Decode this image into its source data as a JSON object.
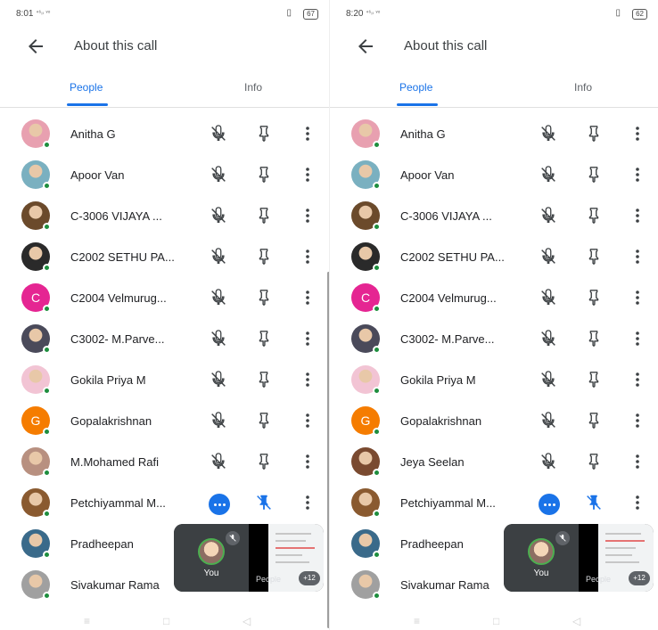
{
  "colors": {
    "accent": "#1a73e8",
    "online": "#1e8e3e",
    "text": "#202124",
    "icon": "#3c4043"
  },
  "screens": [
    {
      "status": {
        "time": "8:01",
        "signal": "⁴⁶ᵢₗ ᵛᵒ",
        "battery": "67"
      },
      "title": "About this call",
      "tabs": {
        "people": "People",
        "info": "Info"
      },
      "participants": [
        {
          "name": "Anitha G",
          "avatar": "photo",
          "color": "#e8a0b0",
          "action": "mute"
        },
        {
          "name": "Apoor Van",
          "avatar": "photo",
          "color": "#7ab0c0",
          "action": "mute"
        },
        {
          "name": "C-3006 VIJAYA ...",
          "avatar": "photo",
          "color": "#6b4a2b",
          "action": "mute"
        },
        {
          "name": "C2002 SETHU PA...",
          "avatar": "photo",
          "color": "#2a2a2a",
          "action": "mute"
        },
        {
          "name": "C2004 Velmurug...",
          "avatar": "letter",
          "initial": "C",
          "color": "#e52592",
          "action": "mute"
        },
        {
          "name": "C3002- M.Parve...",
          "avatar": "photo",
          "color": "#4a4a5a",
          "action": "mute"
        },
        {
          "name": "Gokila Priya M",
          "avatar": "photo",
          "color": "#f2c4d4",
          "action": "mute"
        },
        {
          "name": "Gopalakrishnan",
          "avatar": "letter",
          "initial": "G",
          "color": "#f57c00",
          "action": "mute"
        },
        {
          "name": "M.Mohamed Rafi",
          "avatar": "photo",
          "color": "#b89080",
          "action": "mute"
        },
        {
          "name": "Petchiyammal M...",
          "avatar": "photo",
          "color": "#8a5a30",
          "action": "talking"
        },
        {
          "name": "Pradheepan",
          "avatar": "photo",
          "color": "#3a6a8a",
          "action": "none"
        },
        {
          "name": "Sivakumar Rama",
          "avatar": "photo",
          "color": "#a0a0a0",
          "action": "none"
        }
      ],
      "pip": {
        "you": "You",
        "people": "People",
        "count": "+12"
      }
    },
    {
      "status": {
        "time": "8:20",
        "signal": "⁴⁶ᵢₗ ᵛᵒ",
        "battery": "62"
      },
      "title": "About this call",
      "tabs": {
        "people": "People",
        "info": "Info"
      },
      "participants": [
        {
          "name": "Anitha G",
          "avatar": "photo",
          "color": "#e8a0b0",
          "action": "mute"
        },
        {
          "name": "Apoor Van",
          "avatar": "photo",
          "color": "#7ab0c0",
          "action": "mute"
        },
        {
          "name": "C-3006 VIJAYA ...",
          "avatar": "photo",
          "color": "#6b4a2b",
          "action": "mute"
        },
        {
          "name": "C2002 SETHU PA...",
          "avatar": "photo",
          "color": "#2a2a2a",
          "action": "mute"
        },
        {
          "name": "C2004 Velmurug...",
          "avatar": "letter",
          "initial": "C",
          "color": "#e52592",
          "action": "mute"
        },
        {
          "name": "C3002- M.Parve...",
          "avatar": "photo",
          "color": "#4a4a5a",
          "action": "mute"
        },
        {
          "name": "Gokila Priya M",
          "avatar": "photo",
          "color": "#f2c4d4",
          "action": "mute"
        },
        {
          "name": "Gopalakrishnan",
          "avatar": "letter",
          "initial": "G",
          "color": "#f57c00",
          "action": "mute"
        },
        {
          "name": "Jeya Seelan",
          "avatar": "photo",
          "color": "#7a4a30",
          "action": "mute"
        },
        {
          "name": "Petchiyammal M...",
          "avatar": "photo",
          "color": "#8a5a30",
          "action": "talking"
        },
        {
          "name": "Pradheepan",
          "avatar": "photo",
          "color": "#3a6a8a",
          "action": "none"
        },
        {
          "name": "Sivakumar Rama",
          "avatar": "photo",
          "color": "#a0a0a0",
          "action": "none"
        }
      ],
      "pip": {
        "you": "You",
        "people": "People",
        "count": "+12"
      }
    }
  ],
  "navbar": {
    "menu": "≡",
    "home": "□",
    "back": "◁"
  }
}
